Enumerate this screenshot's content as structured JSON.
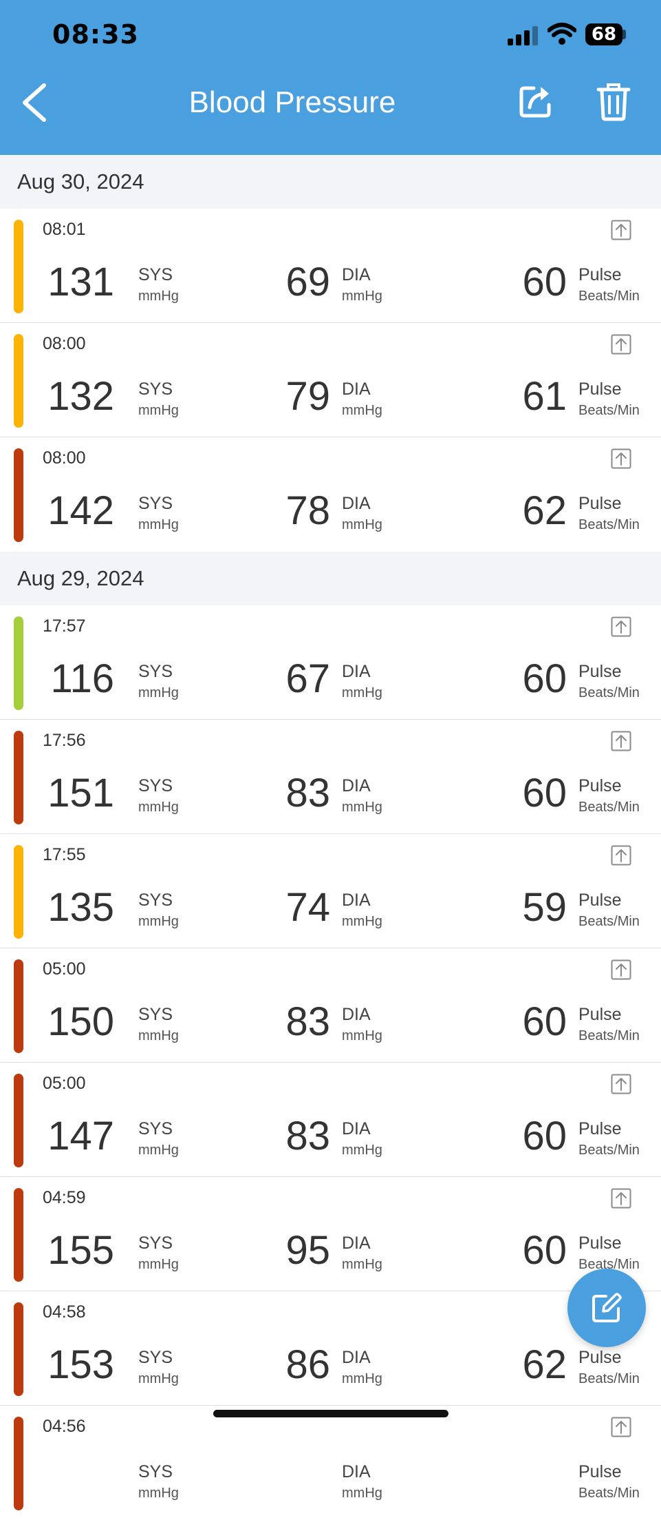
{
  "status_bar": {
    "time": "08:33",
    "battery": "68"
  },
  "header": {
    "title": "Blood Pressure"
  },
  "labels": {
    "sys": "SYS",
    "dia": "DIA",
    "pulse": "Pulse",
    "pressure_unit": "mmHg",
    "pulse_unit": "Beats/Min"
  },
  "colors": {
    "accent": "#4a9fde",
    "elevated": "#fbb305",
    "high": "#bd3a0e",
    "normal": "#a5cf3a"
  },
  "groups": [
    {
      "date": "Aug 30, 2024",
      "readings": [
        {
          "time": "08:01",
          "sys": "131",
          "dia": "69",
          "pulse": "60",
          "level": "elevated"
        },
        {
          "time": "08:00",
          "sys": "132",
          "dia": "79",
          "pulse": "61",
          "level": "elevated"
        },
        {
          "time": "08:00",
          "sys": "142",
          "dia": "78",
          "pulse": "62",
          "level": "high"
        }
      ]
    },
    {
      "date": "Aug 29, 2024",
      "readings": [
        {
          "time": "17:57",
          "sys": "116",
          "dia": "67",
          "pulse": "60",
          "level": "normal"
        },
        {
          "time": "17:56",
          "sys": "151",
          "dia": "83",
          "pulse": "60",
          "level": "high"
        },
        {
          "time": "17:55",
          "sys": "135",
          "dia": "74",
          "pulse": "59",
          "level": "elevated"
        },
        {
          "time": "05:00",
          "sys": "150",
          "dia": "83",
          "pulse": "60",
          "level": "high"
        },
        {
          "time": "05:00",
          "sys": "147",
          "dia": "83",
          "pulse": "60",
          "level": "high"
        },
        {
          "time": "04:59",
          "sys": "155",
          "dia": "95",
          "pulse": "60",
          "level": "high"
        },
        {
          "time": "04:58",
          "sys": "153",
          "dia": "86",
          "pulse": "62",
          "level": "high"
        },
        {
          "time": "04:56",
          "sys": "",
          "dia": "",
          "pulse": "",
          "level": "high"
        }
      ]
    }
  ]
}
